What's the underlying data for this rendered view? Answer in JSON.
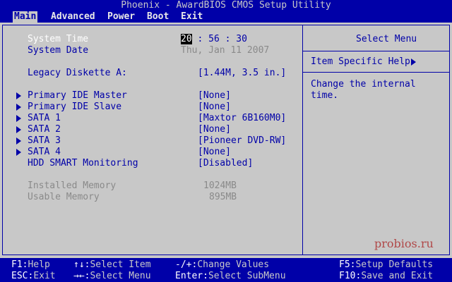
{
  "title": "Phoenix - AwardBIOS CMOS Setup Utility",
  "menu": [
    "Main",
    "Advanced",
    "Power",
    "Boot",
    "Exit"
  ],
  "main": {
    "system_time_label": "System Time",
    "system_time_hour": "20",
    "system_time_rest": ": 56 : 30",
    "system_date_label": "System Date",
    "system_date_value": "Thu, Jan 11 2007",
    "legacy_label": "Legacy Diskette A:",
    "legacy_value": "[1.44M, 3.5 in.]",
    "devices": [
      {
        "label": "Primary IDE Master",
        "value": "[None]"
      },
      {
        "label": "Primary IDE Slave",
        "value": "[None]"
      },
      {
        "label": "SATA 1",
        "value": "[Maxtor 6B160M0]"
      },
      {
        "label": "SATA 2",
        "value": "[None]"
      },
      {
        "label": "SATA 3",
        "value": "[Pioneer DVD-RW]"
      },
      {
        "label": "SATA 4",
        "value": "[None]"
      }
    ],
    "smart_label": "HDD SMART Monitoring",
    "smart_value": "[Disabled]",
    "installed_label": "Installed Memory",
    "installed_value": "1024MB",
    "usable_label": "Usable Memory",
    "usable_value": "895MB"
  },
  "help": {
    "title": "Select Menu",
    "heading": "Item Specific Help",
    "line1": "Change the internal",
    "line2": "time."
  },
  "footer": {
    "f1_key": "F1:",
    "f1_desc": "Help",
    "esc_key": "ESC:",
    "esc_desc": "Exit",
    "item_key": "↑↓:",
    "item_desc": "Select Item",
    "menu_key": "→←:",
    "menu_desc": "Select Menu",
    "change_key": "-/+:",
    "change_desc": "Change Values",
    "enter_key": "Enter:",
    "enter_desc": "Select SubMenu",
    "f5_key": "F5:",
    "f5_desc": "Setup Defaults",
    "f10_key": "F10:",
    "f10_desc": "Save and Exit"
  },
  "watermark": "probios.ru",
  "colors": {
    "background": "#c8c8c8",
    "primary": "#0000a8",
    "highlight": "#ffffff",
    "dimmed": "#8a8a8a"
  }
}
